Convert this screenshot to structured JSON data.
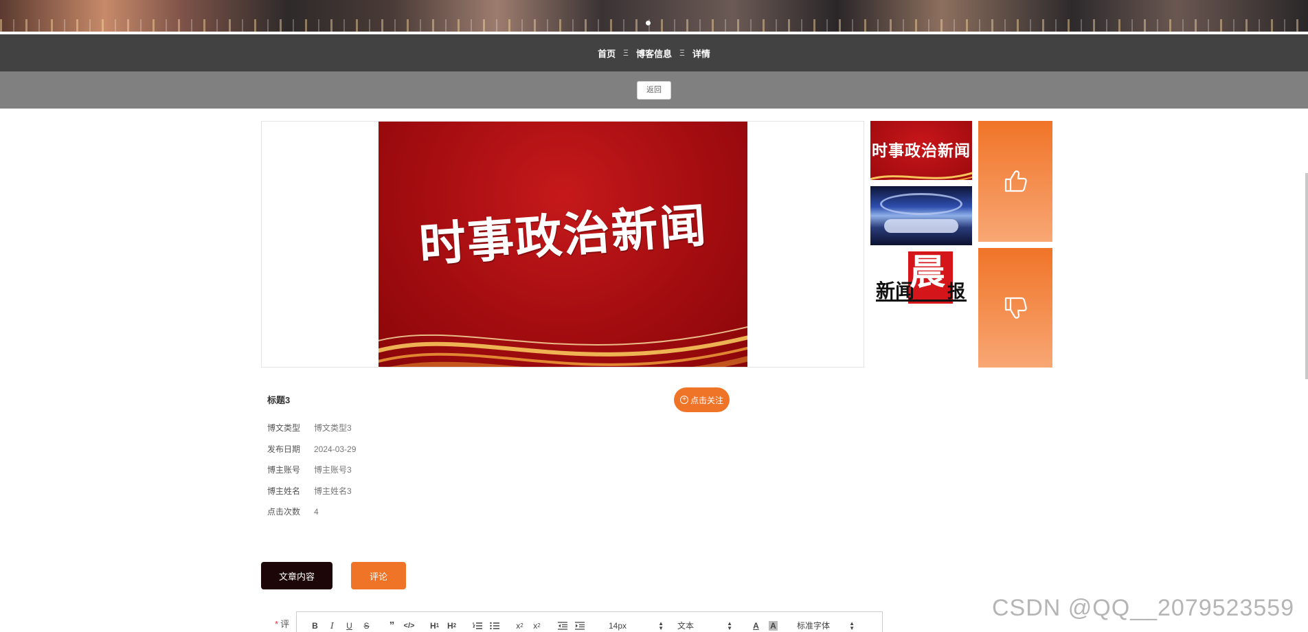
{
  "breadcrumb": {
    "home": "首页",
    "sep": "Ξ",
    "section": "博客信息",
    "current": "详情"
  },
  "back_label": "返回",
  "main_image": {
    "title_text": "时事政治新闻"
  },
  "thumbnails": {
    "t1_text": "时事政治新闻",
    "t3_left": "新闻",
    "t3_big": "晨",
    "t3_right": "报"
  },
  "article": {
    "title": "标题3",
    "follow_label": "点击关注",
    "fields": [
      {
        "label": "博文类型",
        "value": "博文类型3"
      },
      {
        "label": "发布日期",
        "value": "2024-03-29"
      },
      {
        "label": "博主账号",
        "value": "博主账号3"
      },
      {
        "label": "博主姓名",
        "value": "博主姓名3"
      },
      {
        "label": "点击次数",
        "value": "4"
      }
    ]
  },
  "tabs": {
    "content": "文章内容",
    "comment": "评论"
  },
  "comment": {
    "required_mark": "*",
    "label": "评",
    "toolbar": {
      "font_size": "14px",
      "heading": "文本",
      "font_family": "标准字体"
    }
  },
  "watermark": "CSDN @QQ__2079523559",
  "colors": {
    "accent": "#f07428",
    "dark": "#424242",
    "mid": "#808080"
  }
}
